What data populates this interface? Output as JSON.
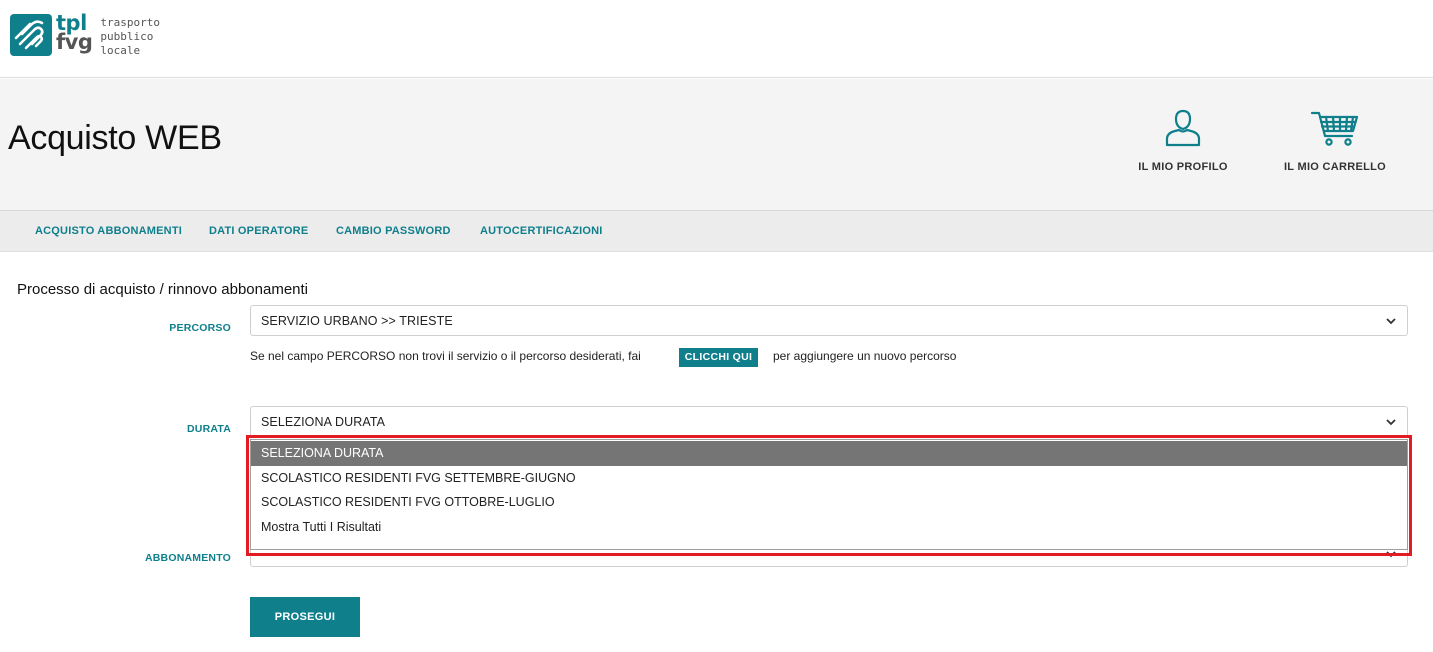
{
  "brand": {
    "word_top": "tpl",
    "word_bottom": "fvg",
    "sub_lines": [
      "trasporto",
      "pubblico",
      "locale"
    ],
    "accent_color": "#0f7f8c"
  },
  "header": {
    "title": "Acquisto WEB",
    "profile_label": "IL MIO PROFILO",
    "profile_icon": "user-icon",
    "cart_label": "IL MIO CARRELLO",
    "cart_icon": "cart-icon"
  },
  "nav": {
    "items": [
      {
        "label": "ACQUISTO ABBONAMENTI"
      },
      {
        "label": "DATI OPERATORE"
      },
      {
        "label": "CAMBIO PASSWORD"
      },
      {
        "label": "AUTOCERTIFICAZIONI"
      }
    ]
  },
  "form": {
    "section_title": "Processo di acquisto / rinnovo abbonamenti",
    "percorso": {
      "label": "PERCORSO",
      "value": "SERVIZIO URBANO >> TRIESTE"
    },
    "hint_before": "Se nel campo PERCORSO non trovi il servizio o il percorso desiderati, fai",
    "hint_button": "CLICCHI QUI",
    "hint_after": "per aggiungere un nuovo percorso",
    "durata": {
      "label": "DURATA",
      "value": "SELEZIONA DURATA",
      "options": [
        {
          "label": "SELEZIONA DURATA"
        },
        {
          "label": "SCOLASTICO RESIDENTI FVG SETTEMBRE-GIUGNO"
        },
        {
          "label": "SCOLASTICO RESIDENTI FVG OTTOBRE-LUGLIO"
        },
        {
          "label": "Mostra Tutti I Risultati"
        }
      ],
      "highlight_color": "#e31b23"
    },
    "abbonamento": {
      "label": "ABBONAMENTO",
      "value": ""
    },
    "submit_label": "PROSEGUI"
  }
}
